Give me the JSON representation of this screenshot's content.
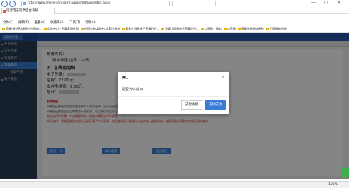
{
  "browser": {
    "url": "http://www.share-san.com/supply/admin/index.aspx",
    "tab_title": "同源电子签章后台系统",
    "menu": [
      "文件(F)",
      "编辑(E)",
      "查看(V)",
      "收藏夹(A)",
      "工具(T)",
      "帮助(H)"
    ],
    "favorites": [
      "同源(SHAREGUN) 中国电...",
      "会员中心 - 不重复源代码",
      "中国金融认证中心CFCA系统",
      "帮助 | 同源电子签章后台...",
      "登录 | 同源电子签章后台...",
      "点签网 - 服务",
      "点签网",
      "签章系统测试系统",
      "迈诺数据系统"
    ],
    "zoom": "100%"
  },
  "app": {
    "sidebar": {
      "logo": "同源电子签",
      "items": [
        "业务管理",
        "电子签章",
        "签章管理",
        "签章管理",
        "签章申请",
        "账户管理"
      ]
    }
  },
  "content": {
    "delivery": "邮寄方式：",
    "delivery_detail": "顺丰快递 运费：22元",
    "section2": "2、总费用明细",
    "esign_label": "电子签章：",
    "shipping": "运费：22.00元",
    "payable": "支付手续费：5.00元",
    "total": "总计：",
    "notice_title": "友情提醒",
    "notice_lines": [
      "如果您还需继续办理其他签章个人电子签章，请点击这里，否则请点击打印保存付款。",
      "如果您还需要您后已审核第一级支付，可以前往未支付订单支付记录，这样才会有一笔是等待状态。",
      "关于支付手续费：本系统提供的一类账户需要支付手续费。",
      "关于支付：如果您需要付款后已经开通了个人签章，并且使用同一张银行卡会产生一张收款单，在您付款后请到工商银行网站查询"
    ],
    "buttons": [
      "返回上一步",
      "联系客服",
      "返回首页"
    ]
  },
  "modal": {
    "title": "确认",
    "message": "是否支付成功？",
    "fail_label": "支付失败",
    "ok_label": "支付成功"
  }
}
